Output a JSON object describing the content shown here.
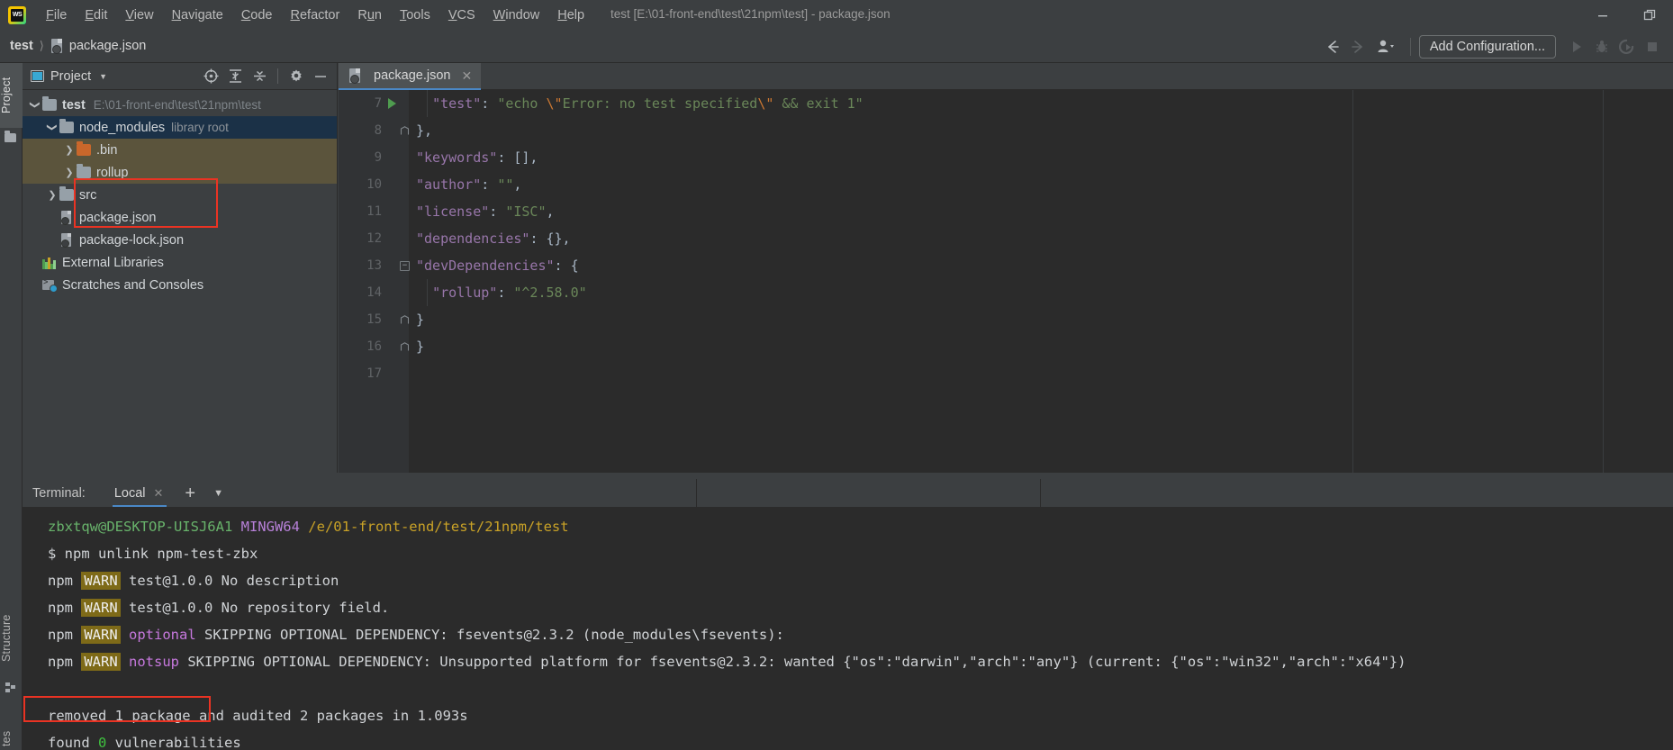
{
  "window": {
    "title": "test [E:\\01-front-end\\test\\21npm\\test] - package.json",
    "minimize_label": "minimize-window",
    "restore_label": "restore-window"
  },
  "menubar": {
    "items": [
      {
        "label": "File",
        "mnemonic": "F"
      },
      {
        "label": "Edit",
        "mnemonic": "E"
      },
      {
        "label": "View",
        "mnemonic": "V"
      },
      {
        "label": "Navigate",
        "mnemonic": "N"
      },
      {
        "label": "Code",
        "mnemonic": "C"
      },
      {
        "label": "Refactor",
        "mnemonic": "R"
      },
      {
        "label": "Run",
        "mnemonic": "u"
      },
      {
        "label": "Tools",
        "mnemonic": "T"
      },
      {
        "label": "VCS",
        "mnemonic": "V"
      },
      {
        "label": "Window",
        "mnemonic": "W"
      },
      {
        "label": "Help",
        "mnemonic": "H"
      }
    ]
  },
  "navbar": {
    "breadcrumb": [
      "test",
      "package.json"
    ],
    "add_configuration": "Add Configuration..."
  },
  "left_tool_strip": {
    "project_tab": "Project",
    "structure_tab": "Structure",
    "favorites_tab": "tes"
  },
  "project_panel": {
    "title": "Project",
    "tree": [
      {
        "label": "test",
        "meta": "E:\\01-front-end\\test\\21npm\\test",
        "icon": "folder-icon",
        "bold": true,
        "indent": 0,
        "arrow": "down",
        "state": "none"
      },
      {
        "label": "node_modules",
        "meta": "library root",
        "icon": "folder-icon",
        "bold": false,
        "indent": 1,
        "arrow": "down",
        "state": "selected"
      },
      {
        "label": ".bin",
        "meta": "",
        "icon": "folder-orange-icon",
        "bold": false,
        "indent": 2,
        "arrow": "right",
        "state": "highlight"
      },
      {
        "label": "rollup",
        "meta": "",
        "icon": "folder-icon",
        "bold": false,
        "indent": 2,
        "arrow": "right",
        "state": "highlight"
      },
      {
        "label": "src",
        "meta": "",
        "icon": "folder-icon",
        "bold": false,
        "indent": 1,
        "arrow": "right",
        "state": "none"
      },
      {
        "label": "package.json",
        "meta": "",
        "icon": "json-file-icon",
        "bold": false,
        "indent": 1,
        "arrow": "none",
        "state": "none"
      },
      {
        "label": "package-lock.json",
        "meta": "",
        "icon": "json-file-icon",
        "bold": false,
        "indent": 1,
        "arrow": "none",
        "state": "none"
      },
      {
        "label": "External Libraries",
        "meta": "",
        "icon": "library-icon",
        "bold": false,
        "indent": 0,
        "arrow": "none",
        "state": "none"
      },
      {
        "label": "Scratches and Consoles",
        "meta": "",
        "icon": "scratches-icon",
        "bold": false,
        "indent": 0,
        "arrow": "none",
        "state": "none"
      }
    ]
  },
  "editor": {
    "tab_label": "package.json",
    "lines": [
      {
        "num": "7",
        "fold": "none",
        "run": true,
        "indent_guide": true,
        "tokens": [
          {
            "t": "  ",
            "c": "pun"
          },
          {
            "t": "\"test\"",
            "c": "key"
          },
          {
            "t": ": ",
            "c": "pun"
          },
          {
            "t": "\"echo ",
            "c": "str"
          },
          {
            "t": "\\\"",
            "c": "esc"
          },
          {
            "t": "Error: no test specified",
            "c": "str"
          },
          {
            "t": "\\\"",
            "c": "esc"
          },
          {
            "t": " && exit 1\"",
            "c": "str"
          }
        ]
      },
      {
        "num": "8",
        "fold": "end",
        "run": false,
        "indent_guide": false,
        "tokens": [
          {
            "t": "},",
            "c": "pun"
          }
        ]
      },
      {
        "num": "9",
        "fold": "none",
        "run": false,
        "indent_guide": false,
        "tokens": [
          {
            "t": "\"keywords\"",
            "c": "key"
          },
          {
            "t": ": [],",
            "c": "pun"
          }
        ]
      },
      {
        "num": "10",
        "fold": "none",
        "run": false,
        "indent_guide": false,
        "tokens": [
          {
            "t": "\"author\"",
            "c": "key"
          },
          {
            "t": ": ",
            "c": "pun"
          },
          {
            "t": "\"\"",
            "c": "str"
          },
          {
            "t": ",",
            "c": "pun"
          }
        ]
      },
      {
        "num": "11",
        "fold": "none",
        "run": false,
        "indent_guide": false,
        "tokens": [
          {
            "t": "\"license\"",
            "c": "key"
          },
          {
            "t": ": ",
            "c": "pun"
          },
          {
            "t": "\"ISC\"",
            "c": "str"
          },
          {
            "t": ",",
            "c": "pun"
          }
        ]
      },
      {
        "num": "12",
        "fold": "none",
        "run": false,
        "indent_guide": false,
        "tokens": [
          {
            "t": "\"dependencies\"",
            "c": "key"
          },
          {
            "t": ": {},",
            "c": "pun"
          }
        ]
      },
      {
        "num": "13",
        "fold": "start",
        "run": false,
        "indent_guide": false,
        "tokens": [
          {
            "t": "\"devDependencies\"",
            "c": "key"
          },
          {
            "t": ": {",
            "c": "pun"
          }
        ]
      },
      {
        "num": "14",
        "fold": "none",
        "run": false,
        "indent_guide": true,
        "tokens": [
          {
            "t": "  ",
            "c": "pun"
          },
          {
            "t": "\"rollup\"",
            "c": "key"
          },
          {
            "t": ": ",
            "c": "pun"
          },
          {
            "t": "\"^2.58.0\"",
            "c": "str"
          }
        ]
      },
      {
        "num": "15",
        "fold": "end",
        "run": false,
        "indent_guide": false,
        "tokens": [
          {
            "t": "}",
            "c": "pun"
          }
        ]
      },
      {
        "num": "16",
        "fold": "end",
        "run": false,
        "indent_guide": false,
        "tokens": [
          {
            "t": "}",
            "c": "pun"
          }
        ]
      },
      {
        "num": "17",
        "fold": "none",
        "run": false,
        "indent_guide": false,
        "tokens": []
      }
    ]
  },
  "terminal": {
    "label": "Terminal:",
    "tab_name": "Local",
    "new_tab_icon": "plus-icon",
    "dropdown_icon": "chevron-down-icon",
    "lines": [
      {
        "segs": [
          {
            "t": "zbxtqw@DESKTOP-UISJ6A1 ",
            "c": "green"
          },
          {
            "t": "MINGW64 ",
            "c": "purple"
          },
          {
            "t": "/e/01-front-end/test/21npm/test",
            "c": "yellow"
          }
        ]
      },
      {
        "segs": [
          {
            "t": "$ npm unlink npm-test-zbx",
            "c": "white"
          }
        ]
      },
      {
        "segs": [
          {
            "t": "npm ",
            "c": "white"
          },
          {
            "t": "WARN",
            "c": "warn"
          },
          {
            "t": " test@1.0.0 No description",
            "c": "white"
          }
        ]
      },
      {
        "segs": [
          {
            "t": "npm ",
            "c": "white"
          },
          {
            "t": "WARN",
            "c": "warn"
          },
          {
            "t": " test@1.0.0 No repository field.",
            "c": "white"
          }
        ]
      },
      {
        "segs": [
          {
            "t": "npm ",
            "c": "white"
          },
          {
            "t": "WARN",
            "c": "warn"
          },
          {
            "t": " ",
            "c": "white"
          },
          {
            "t": "optional",
            "c": "pink"
          },
          {
            "t": " SKIPPING OPTIONAL DEPENDENCY: fsevents@2.3.2 (node_modules\\fsevents):",
            "c": "white"
          }
        ]
      },
      {
        "segs": [
          {
            "t": "npm ",
            "c": "white"
          },
          {
            "t": "WARN",
            "c": "warn"
          },
          {
            "t": " ",
            "c": "white"
          },
          {
            "t": "notsup",
            "c": "pink"
          },
          {
            "t": " SKIPPING OPTIONAL DEPENDENCY: Unsupported platform for fsevents@2.3.2: wanted {\"os\":\"darwin\",\"arch\":\"any\"} (current: {\"os\":\"win32\",\"arch\":\"x64\"})",
            "c": "white"
          }
        ]
      },
      {
        "segs": [
          {
            "t": "",
            "c": "white"
          }
        ]
      },
      {
        "segs": [
          {
            "t": "removed 1 package and audited 2 packages in 1.093s",
            "c": "white"
          }
        ]
      },
      {
        "segs": [
          {
            "t": "found ",
            "c": "white"
          },
          {
            "t": "0",
            "c": "brightgreen"
          },
          {
            "t": " vulnerabilities",
            "c": "white"
          }
        ]
      }
    ]
  },
  "annotations": {
    "tree_box_color": "#ea3323",
    "terminal_box_color": "#ea3323",
    "tree_box_target": "node_modules .bin rollup",
    "terminal_box_target": "removed 1 package"
  },
  "colors": {
    "panel_bg": "#3c3f41",
    "editor_bg": "#2b2b2b",
    "selection_blue": "#1b3147",
    "highlight_olive": "#5b543c",
    "tab_accent": "#4a88c7",
    "annotation_red": "#ea3323"
  }
}
